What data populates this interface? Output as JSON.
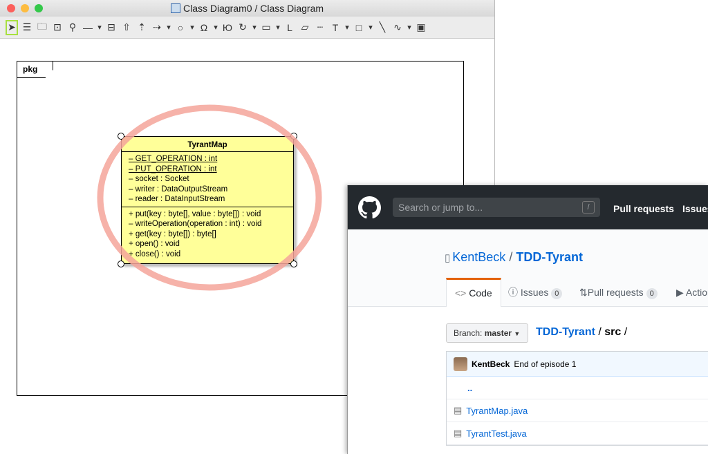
{
  "window": {
    "title": "Class Diagram0 / Class Diagram"
  },
  "toolbar": {
    "tools": [
      "select-icon",
      "class-icon",
      "package-icon",
      "subsystem-icon",
      "pin-icon",
      "association-icon",
      "dropdown",
      "class-compartment-icon",
      "generalization-icon",
      "realization-icon",
      "dependency-icon",
      "dropdown",
      "interface-circle-icon",
      "dropdown",
      "required-interface-icon",
      "dropdown",
      "provided-interface-icon",
      "rotate-icon",
      "dropdown",
      "text-field-icon",
      "dropdown",
      "l-line-icon",
      "note-icon",
      "dashed-line-icon",
      "text-icon",
      "dropdown",
      "rectangle-icon",
      "dropdown",
      "line-icon",
      "curve-icon",
      "dropdown",
      "image-icon"
    ]
  },
  "diagram": {
    "package_label": "pkg",
    "class": {
      "name": "TyrantMap",
      "static_attributes": [
        "– GET_OPERATION : int",
        "– PUT_OPERATION : int"
      ],
      "attributes": [
        "– socket : Socket",
        "– writer : DataOutputStream",
        "– reader : DataInputStream"
      ],
      "operations": [
        "+ put(key : byte[], value : byte[]) : void",
        "– writeOperation(operation : int) : void",
        "+ get(key : byte[]) : byte[]",
        "+ open() : void",
        "+ close() : void"
      ]
    },
    "highlight_color": "#f4a49a"
  },
  "github": {
    "search_placeholder": "Search or jump to...",
    "search_shortcut": "/",
    "nav": [
      "Pull requests",
      "Issues"
    ],
    "owner": "KentBeck",
    "sep": "/",
    "repo": "TDD-Tyrant",
    "tabs": {
      "code": "Code",
      "issues": "Issues",
      "issues_count": "0",
      "pulls": "Pull requests",
      "pulls_count": "0",
      "actions": "Actions"
    },
    "branch_label": "Branch:",
    "branch": "master",
    "path_repo": "TDD-Tyrant",
    "path_sep": "/",
    "path_dir": "src",
    "path_end": "/",
    "commit_author": "KentBeck",
    "commit_msg": "End of episode 1",
    "parent": "..",
    "files": [
      "TyrantMap.java",
      "TyrantTest.java"
    ]
  }
}
